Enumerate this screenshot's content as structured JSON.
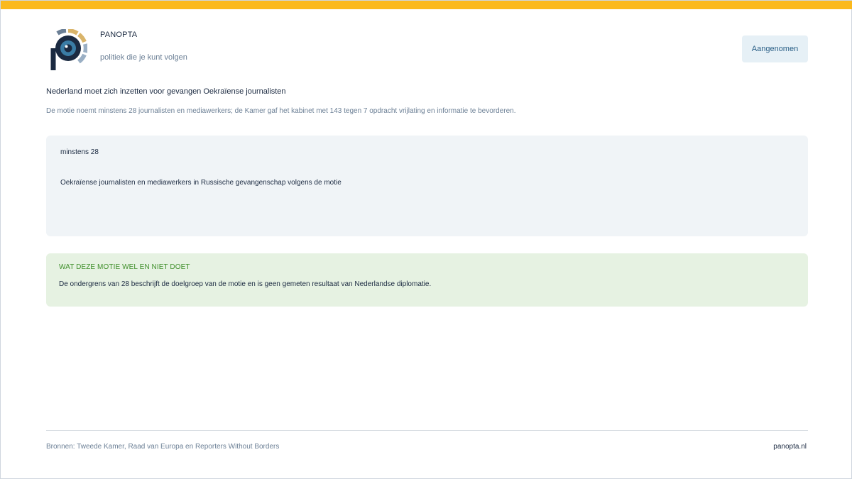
{
  "brand": {
    "name": "PANOPTA",
    "tagline": "politiek die je kunt volgen"
  },
  "status": {
    "label": "Aangenomen"
  },
  "headline": {
    "title": "Nederland moet zich inzetten voor gevangen Oekraïense journalisten",
    "summary": "De motie noemt minstens 28 journalisten en mediawerkers; de Kamer gaf het kabinet met 143 tegen 7 opdracht vrijlating en informatie te bevorderen."
  },
  "stat": {
    "value": "minstens 28",
    "description": "Oekraïense journalisten en mediawerkers in Russische gevangenschap volgens de motie"
  },
  "note": {
    "heading": "WAT DEZE MOTIE WEL EN NIET DOET",
    "body": "De ondergrens van 28 beschrijft de doelgroep van de motie en is geen gemeten resultaat van Nederlandse diplomatie."
  },
  "footer": {
    "sources": "Bronnen: Tweede Kamer, Raad van Europa en Reporters Without Borders",
    "site": "panopta.nl"
  },
  "colors": {
    "accent_bar": "#fbb91d",
    "logo_navy": "#1b2a41",
    "logo_blue": "#3a7ca5",
    "logo_gold": "#d9b46a",
    "note_green": "#3f8f2a"
  }
}
